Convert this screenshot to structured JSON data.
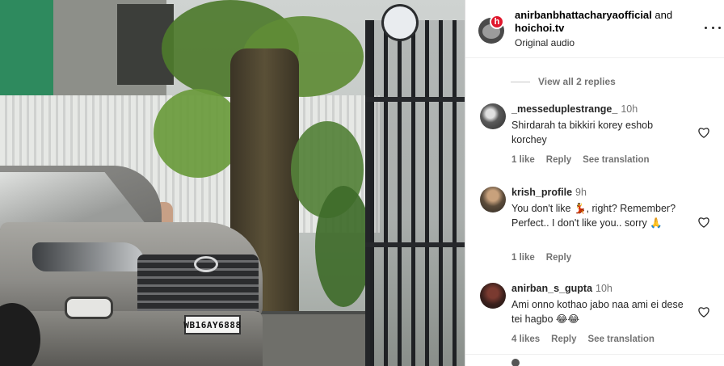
{
  "post": {
    "plate_text": "WB16AY6888"
  },
  "header": {
    "author": "anirbanbhattacharyaofficial",
    "conjunction": "and",
    "collaborator": "hoichoi.tv",
    "audio": "Original audio",
    "badge": "h"
  },
  "thread": {
    "view_replies": "View all 2 replies"
  },
  "comments": [
    {
      "username": "_messeduplestrange_",
      "time": "10h",
      "text": "Shirdarah ta bikkiri korey eshob korchey",
      "likes": "1 like",
      "reply": "Reply",
      "translation": "See translation"
    },
    {
      "username": "krish_profile",
      "time": "9h",
      "text_pre": "You don't like ",
      "text_emoji": "💃",
      "text_post": ", right? Remember? Perfect.. I don't like you.. sorry ",
      "text_emoji2": "🙏",
      "likes": "1 like",
      "reply": "Reply"
    },
    {
      "username": "anirban_s_gupta",
      "time": "10h",
      "text": "Ami onno kothao jabo naa ami ei dese tei hagbo ",
      "text_emoji": "😂😂",
      "likes": "4 likes",
      "reply": "Reply",
      "translation": "See translation"
    }
  ]
}
